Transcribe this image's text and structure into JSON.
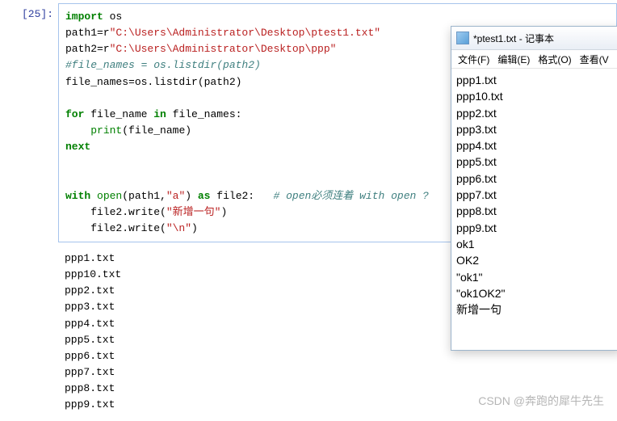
{
  "prompt": "[25]:",
  "code": {
    "l1_import": "import",
    "l1_os": " os",
    "l2a": "path1=r",
    "l2s": "\"C:\\Users\\Administrator\\Desktop\\ptest1.txt\"",
    "l3a": "path2=r",
    "l3s": "\"C:\\Users\\Administrator\\Desktop\\ppp\"",
    "l4c": "#file_names = os.listdir(path2)",
    "l5a": "file_names=os.listdir(path2)",
    "l7a": "for",
    "l7b": " file_name ",
    "l7c": "in",
    "l7d": " file_names:",
    "l8a": "    ",
    "l8p": "print",
    "l8b": "(file_name)",
    "l9": "next",
    "l12a": "with",
    "l12b": " ",
    "l12o": "open",
    "l12c": "(path1,",
    "l12s": "\"a\"",
    "l12d": ") ",
    "l12as": "as",
    "l12e": " file2:   ",
    "l12cmt": "# open必须连着 with open ?",
    "l13a": "    file2.write(",
    "l13s": "\"新增一句\"",
    "l13b": ")",
    "l14a": "    file2.write(",
    "l14s": "\"\\n\"",
    "l14b": ")"
  },
  "output": [
    "ppp1.txt",
    "ppp10.txt",
    "ppp2.txt",
    "ppp3.txt",
    "ppp4.txt",
    "ppp5.txt",
    "ppp6.txt",
    "ppp7.txt",
    "ppp8.txt",
    "ppp9.txt"
  ],
  "notepad": {
    "title": "*ptest1.txt - 记事本",
    "menu": [
      "文件(F)",
      "编辑(E)",
      "格式(O)",
      "查看(V"
    ],
    "lines": [
      "ppp1.txt",
      "ppp10.txt",
      "ppp2.txt",
      "ppp3.txt",
      "ppp4.txt",
      "ppp5.txt",
      "ppp6.txt",
      "ppp7.txt",
      "ppp8.txt",
      "ppp9.txt",
      "ok1",
      "OK2",
      "\"ok1\"",
      "\"ok1OK2\"",
      "新增一句"
    ]
  },
  "watermark": "CSDN @奔跑的犀牛先生"
}
